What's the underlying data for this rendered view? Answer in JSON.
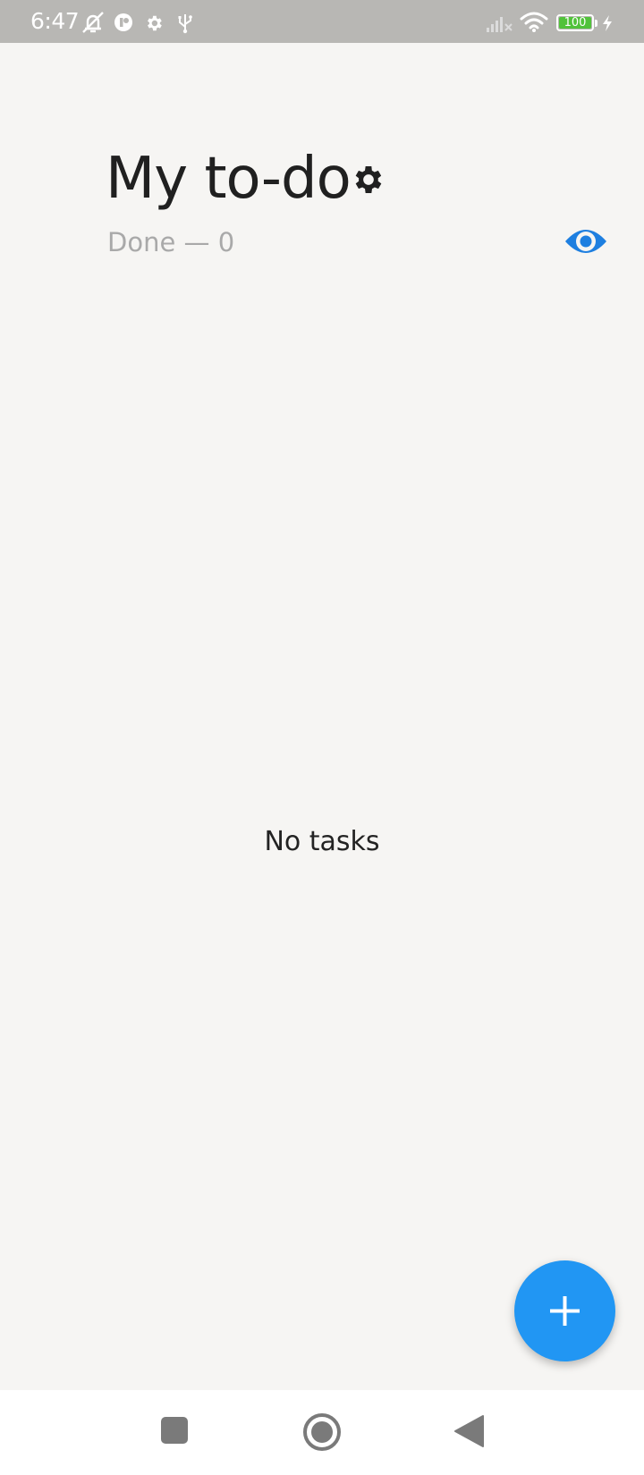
{
  "status_bar": {
    "time": "6:47",
    "battery_level": "100",
    "icons": [
      "mute-icon",
      "notification-app-icon",
      "settings-gear-icon",
      "usb-icon",
      "signal-no-service-icon",
      "wifi-icon",
      "battery-icon",
      "charging-icon"
    ]
  },
  "header": {
    "title": "My to-do",
    "done_label": "Done — 0",
    "settings_icon": "gear-icon",
    "visibility_icon": "eye-icon"
  },
  "main": {
    "empty_message": "No tasks"
  },
  "fab": {
    "icon": "plus-icon"
  },
  "nav_bar": {
    "buttons": [
      "recents-square-icon",
      "home-circle-icon",
      "back-triangle-icon"
    ]
  },
  "colors": {
    "background": "#f6f5f3",
    "accent": "#2196f3",
    "eye": "#1e7fe0",
    "status_bar": "#b8b7b4",
    "battery_fill": "#51c23a"
  }
}
